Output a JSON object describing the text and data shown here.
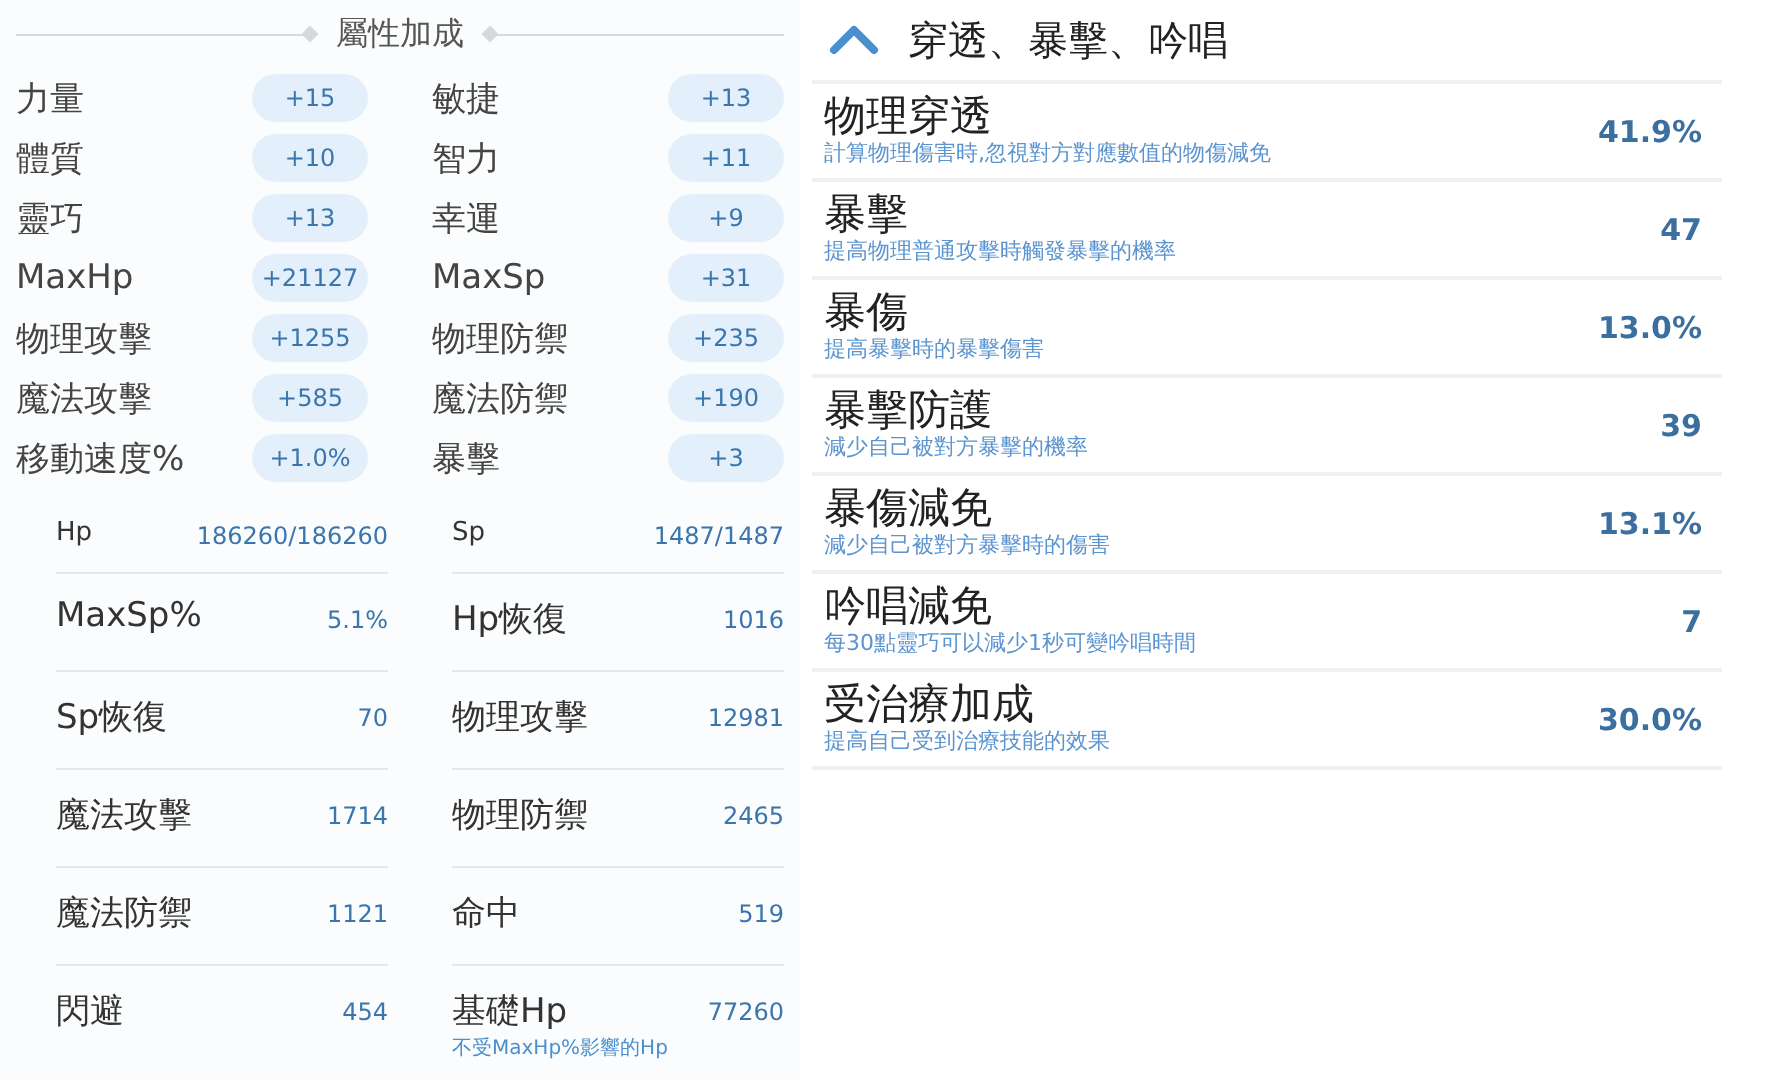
{
  "bonus_panel": {
    "title": "屬性加成",
    "items": [
      {
        "label": "力量",
        "value": "+15"
      },
      {
        "label": "敏捷",
        "value": "+13"
      },
      {
        "label": "體質",
        "value": "+10"
      },
      {
        "label": "智力",
        "value": "+11"
      },
      {
        "label": "靈巧",
        "value": "+13"
      },
      {
        "label": "幸運",
        "value": "+9"
      },
      {
        "label": "MaxHp",
        "value": "+21127"
      },
      {
        "label": "MaxSp",
        "value": "+31"
      },
      {
        "label": "物理攻擊",
        "value": "+1255"
      },
      {
        "label": "物理防禦",
        "value": "+235"
      },
      {
        "label": "魔法攻擊",
        "value": "+585"
      },
      {
        "label": "魔法防禦",
        "value": "+190"
      },
      {
        "label": "移動速度%",
        "value": "+1.0%"
      },
      {
        "label": "暴擊",
        "value": "+3"
      }
    ]
  },
  "stats": [
    {
      "label": "Hp",
      "value": "186260/186260"
    },
    {
      "label": "Sp",
      "value": "1487/1487"
    },
    {
      "label": "MaxSp%",
      "value": "5.1%"
    },
    {
      "label": "Hp恢復",
      "value": "1016"
    },
    {
      "label": "Sp恢復",
      "value": "70"
    },
    {
      "label": "物理攻擊",
      "value": "12981"
    },
    {
      "label": "魔法攻擊",
      "value": "1714"
    },
    {
      "label": "物理防禦",
      "value": "2465"
    },
    {
      "label": "魔法防禦",
      "value": "1121"
    },
    {
      "label": "命中",
      "value": "519"
    },
    {
      "label": "閃避",
      "value": "454"
    },
    {
      "label": "基礎Hp",
      "value": "77260",
      "note": "不受MaxHp%影響的Hp"
    }
  ],
  "section": {
    "title": "穿透、暴擊、吟唱",
    "expanded": true,
    "items": [
      {
        "name": "物理穿透",
        "description": "計算物理傷害時,忽視對方對應數值的物傷減免",
        "value": "41.9%"
      },
      {
        "name": "暴擊",
        "description": "提高物理普通攻擊時觸發暴擊的機率",
        "value": "47"
      },
      {
        "name": "暴傷",
        "description": "提高暴擊時的暴擊傷害",
        "value": "13.0%"
      },
      {
        "name": "暴擊防護",
        "description": "減少自己被對方暴擊的機率",
        "value": "39"
      },
      {
        "name": "暴傷減免",
        "description": "減少自己被對方暴擊時的傷害",
        "value": "13.1%"
      },
      {
        "name": "吟唱減免",
        "description": "每30點靈巧可以減少1秒可變吟唱時間",
        "value": "7"
      },
      {
        "name": "受治療加成",
        "description": "提高自己受到治療技能的效果",
        "value": "30.0%"
      }
    ]
  }
}
